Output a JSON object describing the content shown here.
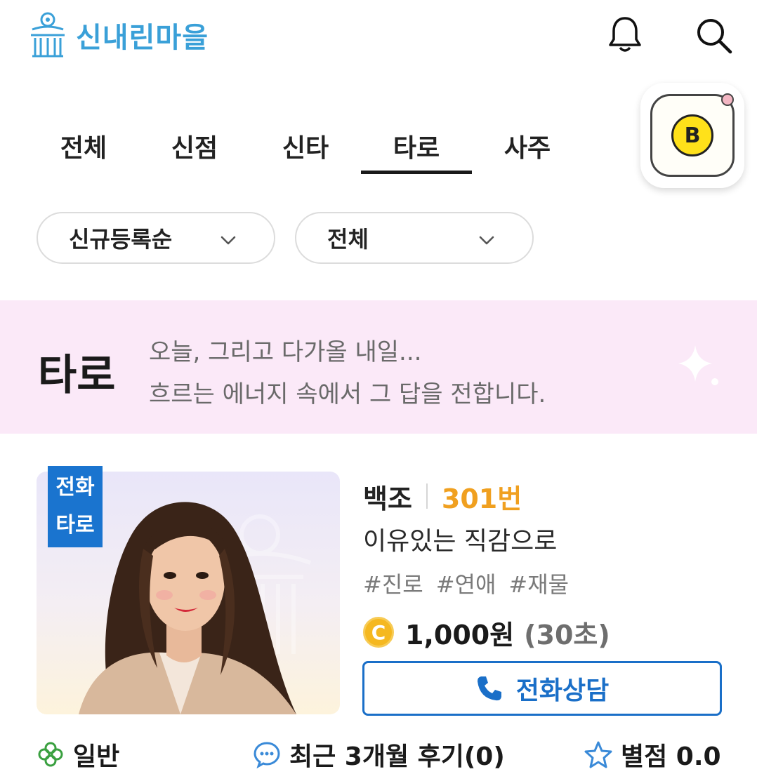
{
  "header": {
    "logo_text": "신내린마을",
    "brand_color": "#3aa0d8",
    "icons": [
      "bell-icon",
      "search-icon"
    ]
  },
  "tabs": [
    {
      "label": "전체",
      "active": false
    },
    {
      "label": "신점",
      "active": false
    },
    {
      "label": "신타",
      "active": false
    },
    {
      "label": "타로",
      "active": true
    },
    {
      "label": "사주",
      "active": false
    }
  ],
  "kakao_button": {
    "letter": "B"
  },
  "filters": {
    "sort": "신규등록순",
    "category": "전체"
  },
  "banner": {
    "title": "타로",
    "line1": "오늘, 그리고 다가올 내일...",
    "line2": "흐르는 에너지 속에서 그 답을 전합니다.",
    "background": "#fbe9f8"
  },
  "card": {
    "badge_line1": "전화",
    "badge_line2": "타로",
    "name": "백조",
    "number": "301번",
    "slogan": "이유있는 직감으로",
    "hashtags": [
      "#진로",
      "#연애",
      "#재물"
    ],
    "coin_letter": "C",
    "price": "1,000원",
    "unit": "(30초)",
    "call_label": "전화상담"
  },
  "stats": {
    "grade": "일반",
    "reviews": "최근 3개월 후기(0)",
    "rating": "별점 0.0"
  }
}
